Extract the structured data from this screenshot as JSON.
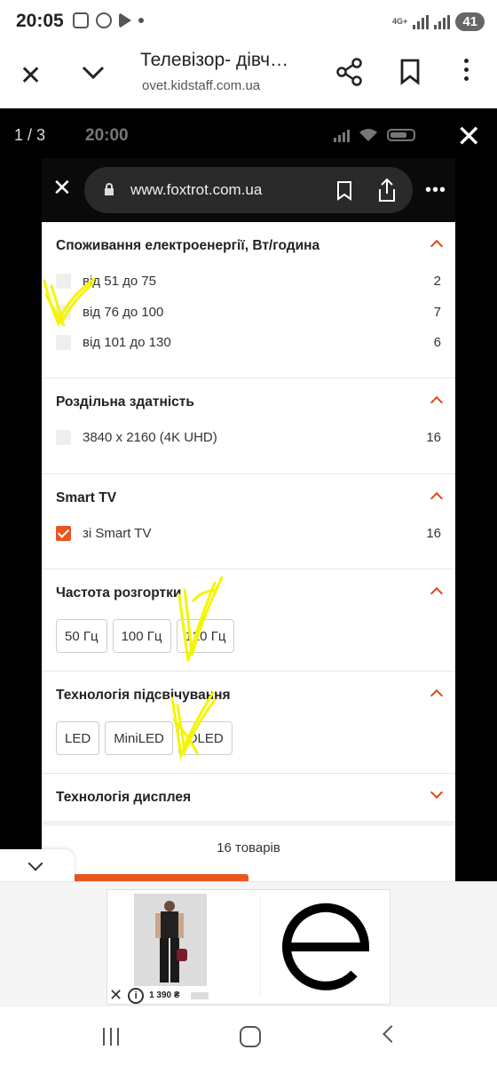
{
  "status_bar": {
    "time": "20:05",
    "network": "4G+",
    "battery": "41"
  },
  "tab_header": {
    "title": "Телевізор- дівч…",
    "url": "ovet.kidstaff.com.ua"
  },
  "viewer": {
    "counter": "1 / 3",
    "inner_time": "20:00",
    "inner_url": "www.foxtrot.com.ua"
  },
  "filters": {
    "power": {
      "title": "Споживання електроенергії, Вт/година",
      "options": [
        {
          "label": "від 51 до 75",
          "count": "2",
          "checked": false
        },
        {
          "label": "від 76 до 100",
          "count": "7",
          "checked": false
        },
        {
          "label": "від 101 до 130",
          "count": "6",
          "checked": false
        }
      ]
    },
    "resolution": {
      "title": "Роздільна здатність",
      "options": [
        {
          "label": "3840 x 2160 (4K UHD)",
          "count": "16",
          "checked": false
        }
      ]
    },
    "smart_tv": {
      "title": "Smart TV",
      "options": [
        {
          "label": "зі Smart TV",
          "count": "16",
          "checked": true
        }
      ]
    },
    "refresh_rate": {
      "title": "Частота розгортки",
      "chips": [
        "50 Гц",
        "100 Гц",
        "120 Гц"
      ]
    },
    "backlight": {
      "title": "Технологія підсвічування",
      "chips": [
        "LED",
        "MiniLED",
        "OLED"
      ]
    },
    "display_tech": {
      "title": "Технологія дисплея"
    }
  },
  "results": {
    "label": "16 товарів"
  },
  "ad": {
    "price": "1 390 ₴",
    "info_glyph": "i"
  },
  "colors": {
    "accent": "#e8561e",
    "highlighter": "#f5f500"
  }
}
